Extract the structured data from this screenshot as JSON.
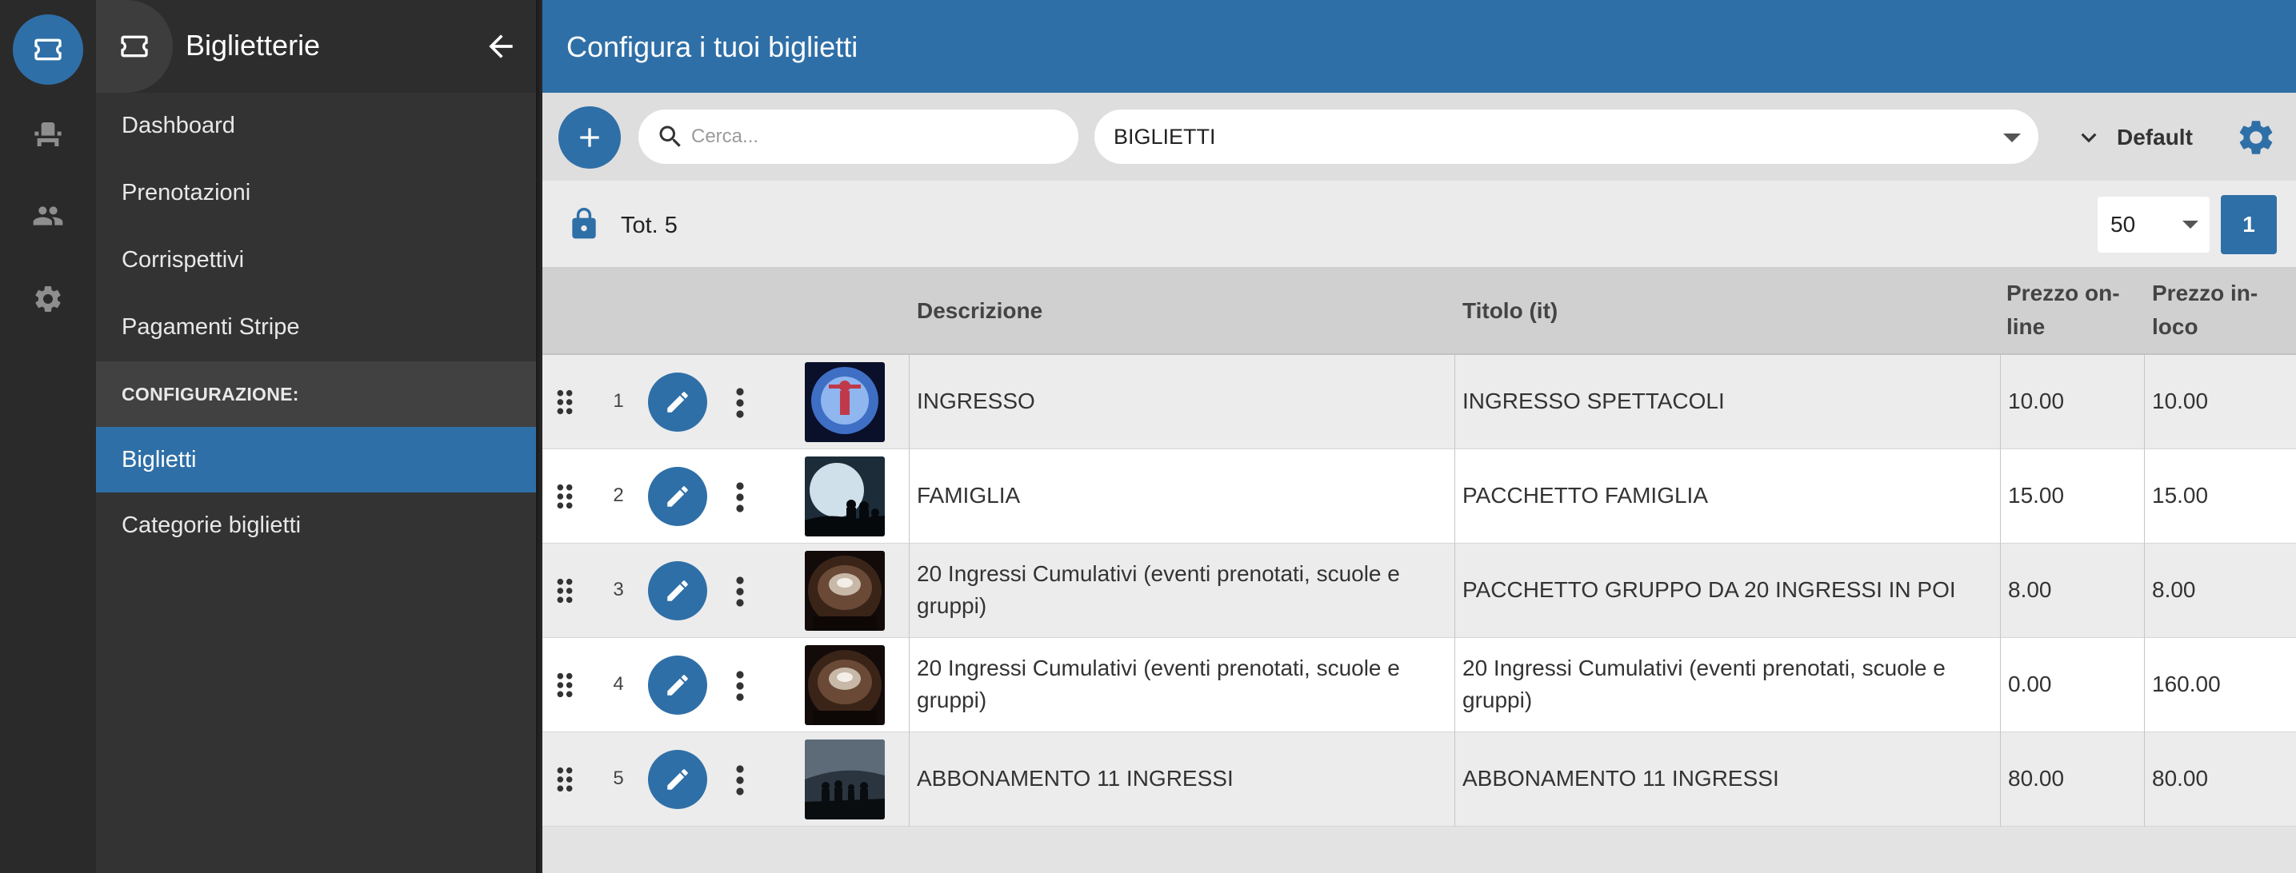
{
  "rail": {
    "items": [
      {
        "icon": "ticket-icon",
        "active": true
      },
      {
        "icon": "event-seat-icon",
        "active": false
      },
      {
        "icon": "people-icon",
        "active": false
      },
      {
        "icon": "gear-icon",
        "active": false
      }
    ]
  },
  "sidebar": {
    "title": "Biglietterie",
    "header_icon": "ticket-icon",
    "back_icon": "arrow-back-icon",
    "items": [
      {
        "label": "Dashboard"
      },
      {
        "label": "Prenotazioni"
      },
      {
        "label": "Corrispettivi"
      },
      {
        "label": "Pagamenti Stripe"
      },
      {
        "label": "CONFIGURAZIONE:",
        "section": true
      },
      {
        "label": "Biglietti",
        "active": true
      },
      {
        "label": "Categorie biglietti"
      }
    ]
  },
  "topbar": {
    "title": "Configura i tuoi biglietti"
  },
  "toolbar": {
    "add_icon": "plus-icon",
    "search_placeholder": "Cerca...",
    "search_value": "",
    "select_value": "BIGLIETTI",
    "default_label": "Default",
    "settings_icon": "gear-icon"
  },
  "infobar": {
    "lock_icon": "lock-icon",
    "total": "Tot. 5",
    "page_size": "50",
    "page": "1"
  },
  "table": {
    "headers": {
      "descrizione": "Descrizione",
      "titolo": "Titolo (it)",
      "prezzo_online": "Prezzo on-line",
      "prezzo_loco": "Prezzo in-loco"
    },
    "rows": [
      {
        "index": "1",
        "descrizione": "INGRESSO",
        "titolo": "INGRESSO SPETTACOLI",
        "prezzo_online": "10.00",
        "prezzo_loco": "10.00",
        "thumb": "dome-person"
      },
      {
        "index": "2",
        "descrizione": "FAMIGLIA",
        "titolo": "PACCHETTO FAMIGLIA",
        "prezzo_online": "15.00",
        "prezzo_loco": "15.00",
        "thumb": "moon-family"
      },
      {
        "index": "3",
        "descrizione": "20 Ingressi Cumulativi (eventi prenotati, scuole e gruppi)",
        "titolo": "PACCHETTO GRUPPO DA 20 INGRESSI IN POI",
        "prezzo_online": "8.00",
        "prezzo_loco": "8.00",
        "thumb": "planetarium"
      },
      {
        "index": "4",
        "descrizione": "20 Ingressi Cumulativi (eventi prenotati, scuole e gruppi)",
        "titolo": "20 Ingressi Cumulativi (eventi prenotati, scuole e gruppi)",
        "prezzo_online": "0.00",
        "prezzo_loco": "160.00",
        "thumb": "planetarium"
      },
      {
        "index": "5",
        "descrizione": "ABBONAMENTO 11 INGRESSI",
        "titolo": "ABBONAMENTO 11 INGRESSI",
        "prezzo_online": "80.00",
        "prezzo_loco": "80.00",
        "thumb": "night-group"
      }
    ]
  },
  "colors": {
    "primary": "#2f6fa7",
    "sidebar": "#333333",
    "rail": "#2a2a2a"
  }
}
